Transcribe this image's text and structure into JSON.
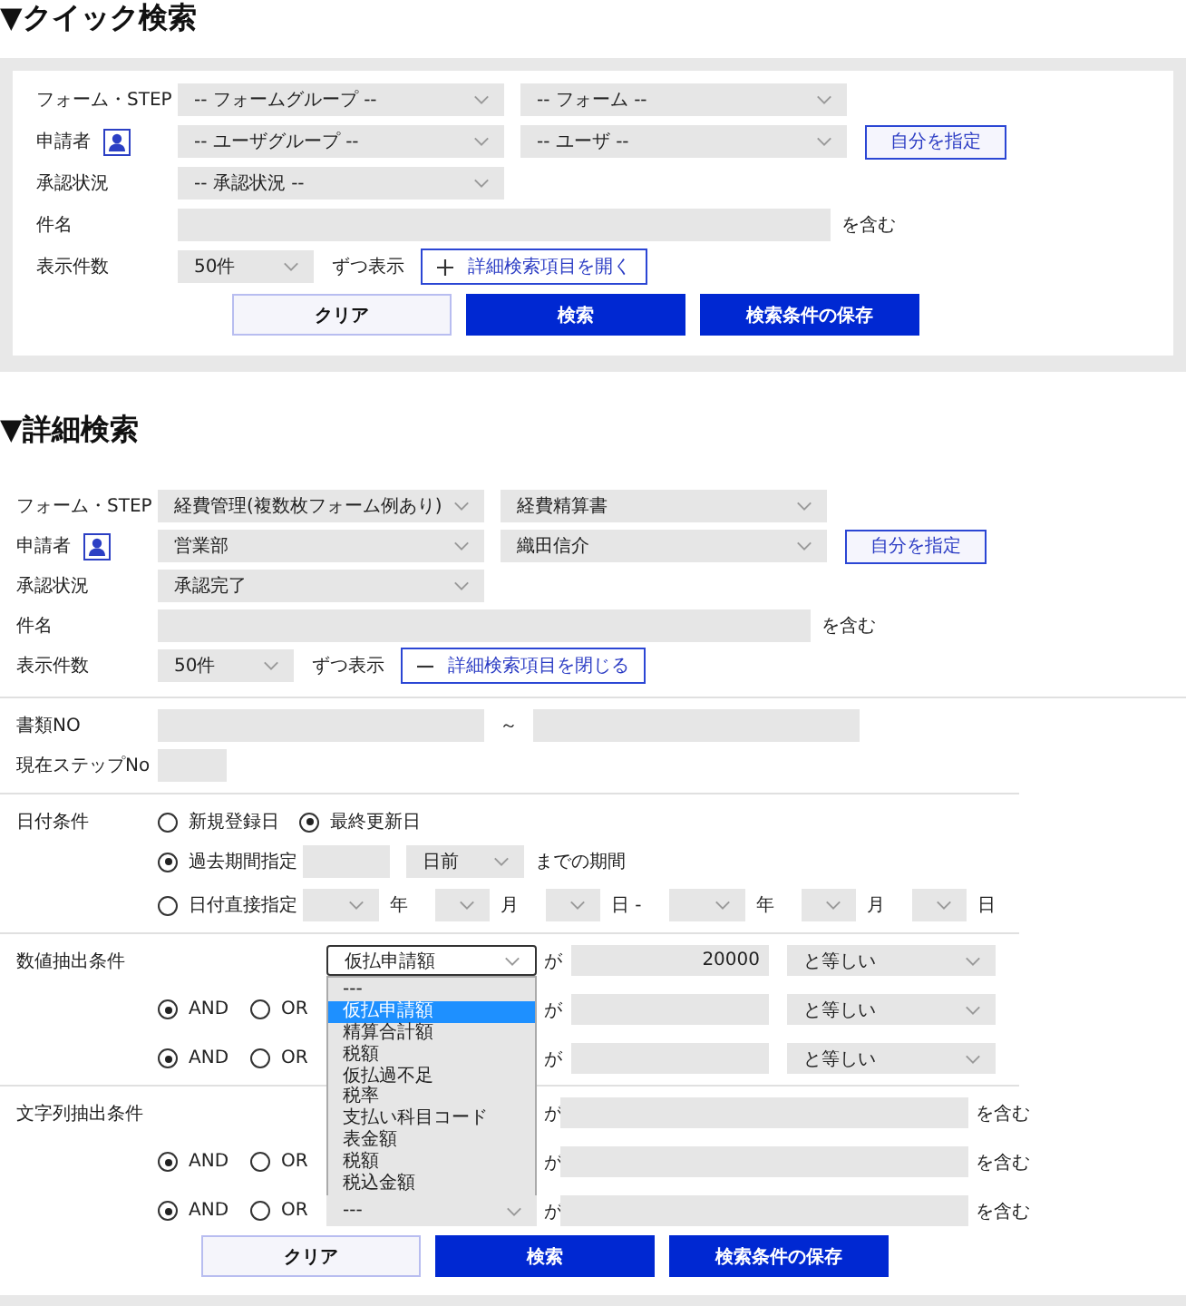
{
  "quick_search": {
    "heading": "▼クイック検索",
    "filters": {
      "form_step": {
        "label": "フォーム・STEP",
        "group": "-- フォームグループ --",
        "form": "-- フォーム --"
      },
      "applicant": {
        "label": "申請者",
        "group": "-- ユーザグループ --",
        "user": "-- ユーザ --",
        "self_button": "自分を指定"
      },
      "approval": {
        "label": "承認状況",
        "status": "-- 承認状況 --"
      },
      "subject": {
        "label": "件名",
        "suffix": "を含む"
      },
      "page_size": {
        "label": "表示件数",
        "value": "50件",
        "suffix": "ずつ表示",
        "toggle": {
          "kind": "expand",
          "label": "詳細検索項目を開く"
        }
      }
    },
    "actions": [
      {
        "label": "クリア",
        "kind": "secondary"
      },
      {
        "label": "検索",
        "kind": "primary"
      },
      {
        "label": "検索条件の保存",
        "kind": "primary"
      }
    ]
  },
  "detail_search": {
    "heading": "▼詳細検索",
    "filters": {
      "form_step": {
        "label": "フォーム・STEP",
        "group": "経費管理(複数枚フォーム例あり)",
        "form": "経費精算書"
      },
      "applicant": {
        "label": "申請者",
        "group": "営業部",
        "user": "織田信介",
        "self_button": "自分を指定"
      },
      "approval": {
        "label": "承認状況",
        "status": "承認完了"
      },
      "subject": {
        "label": "件名",
        "suffix": "を含む"
      },
      "page_size": {
        "label": "表示件数",
        "value": "50件",
        "suffix": "ずつ表示",
        "toggle": {
          "kind": "collapse",
          "label": "詳細検索項目を閉じる"
        }
      }
    },
    "document_no": {
      "label": "書類NO",
      "separator": "～"
    },
    "step_no": {
      "label": "現在ステップNo"
    },
    "date_condition": {
      "label": "日付条件",
      "basis": [
        {
          "label": "新規登録日",
          "selected": false
        },
        {
          "label": "最終更新日",
          "selected": true
        }
      ],
      "period": {
        "label": "過去期間指定",
        "selected": true,
        "unit": "日前",
        "suffix": "までの期間"
      },
      "direct": {
        "label": "日付直接指定",
        "selected": false,
        "units": [
          "年",
          "月",
          "日 -",
          "年",
          "月",
          "日"
        ]
      }
    },
    "numeric_condition": {
      "label": "数値抽出条件",
      "rows": [
        {
          "field": {
            "value": "仮払申請額",
            "open": true,
            "options": [
              {
                "label": "---",
                "selected": false
              },
              {
                "label": "仮払申請額",
                "selected": true
              },
              {
                "label": "精算合計額",
                "selected": false
              },
              {
                "label": "税額",
                "selected": false
              },
              {
                "label": "仮払過不足",
                "selected": false
              },
              {
                "label": "税率",
                "selected": false
              },
              {
                "label": "支払い科目コード",
                "selected": false
              },
              {
                "label": "表金額",
                "selected": false
              },
              {
                "label": "税額",
                "selected": false
              },
              {
                "label": "税込金額",
                "selected": false
              }
            ]
          },
          "particle": "が",
          "value": "20000",
          "operator": "と等しい"
        },
        {
          "logic": [
            {
              "label": "AND",
              "selected": true
            },
            {
              "label": "OR",
              "selected": false
            }
          ],
          "particle": "が",
          "operator": "と等しい"
        },
        {
          "logic": [
            {
              "label": "AND",
              "selected": true
            },
            {
              "label": "OR",
              "selected": false
            }
          ],
          "particle": "が",
          "operator": "と等しい"
        }
      ]
    },
    "string_condition": {
      "label": "文字列抽出条件",
      "rows": [
        {
          "particle": "が",
          "suffix": "を含む"
        },
        {
          "logic": [
            {
              "label": "AND",
              "selected": true
            },
            {
              "label": "OR",
              "selected": false
            }
          ],
          "particle": "が",
          "suffix": "を含む"
        },
        {
          "logic": [
            {
              "label": "AND",
              "selected": true
            },
            {
              "label": "OR",
              "selected": false
            }
          ],
          "field": {
            "value": "---",
            "open": false
          },
          "particle": "が",
          "suffix": "を含む"
        }
      ]
    },
    "actions": [
      {
        "label": "クリア",
        "kind": "secondary"
      },
      {
        "label": "検索",
        "kind": "primary"
      },
      {
        "label": "検索条件の保存",
        "kind": "primary"
      }
    ]
  }
}
